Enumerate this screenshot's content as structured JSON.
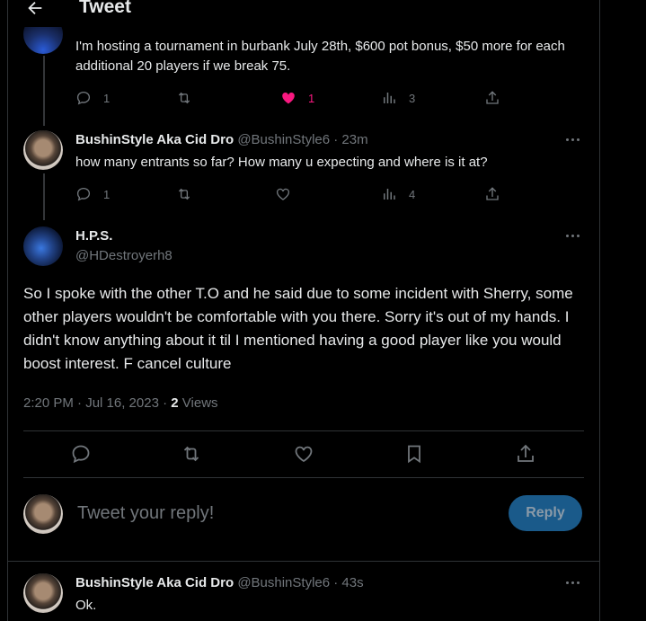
{
  "header": {
    "title": "Tweet"
  },
  "tweets": [
    {
      "text": "I'm hosting a tournament in burbank July 28th, $600 pot bonus, $50 more for each additional 20 players if we break 75.",
      "replies": "1",
      "likes": "1",
      "views": "3"
    },
    {
      "name": "BushinStyle Aka Cid Dro",
      "handle": "@BushinStyle6",
      "time": "· 23m",
      "text": "how many entrants so far? How many u expecting and where is it at?",
      "replies": "1",
      "views": "4"
    }
  ],
  "main_tweet": {
    "name": "H.P.S.",
    "handle": "@HDestroyerh8",
    "text": "So I spoke with the other T.O and he said due to some incident with Sherry, some other players wouldn't be comfortable with you there. Sorry it's out of my hands.  I didn't know anything about it til I mentioned having a good player like you would boost interest. F cancel culture",
    "timestamp": "2:20 PM · Jul 16, 2023 ·",
    "views_count": "2",
    "views_label": "Views"
  },
  "composer": {
    "placeholder": "Tweet your reply!",
    "reply_label": "Reply"
  },
  "last_reply": {
    "name": "BushinStyle Aka Cid Dro",
    "handle": "@BushinStyle6",
    "time": "· 43s",
    "text": "Ok."
  },
  "colors": {
    "accent": "#1d9bf0",
    "like": "#f91880",
    "muted": "#71767b",
    "reply_button_bg": "#1a5a8a"
  },
  "icons": [
    "back-arrow-icon",
    "reply-icon",
    "retweet-icon",
    "heart-icon",
    "views-icon",
    "share-icon",
    "bookmark-icon",
    "more-icon"
  ]
}
